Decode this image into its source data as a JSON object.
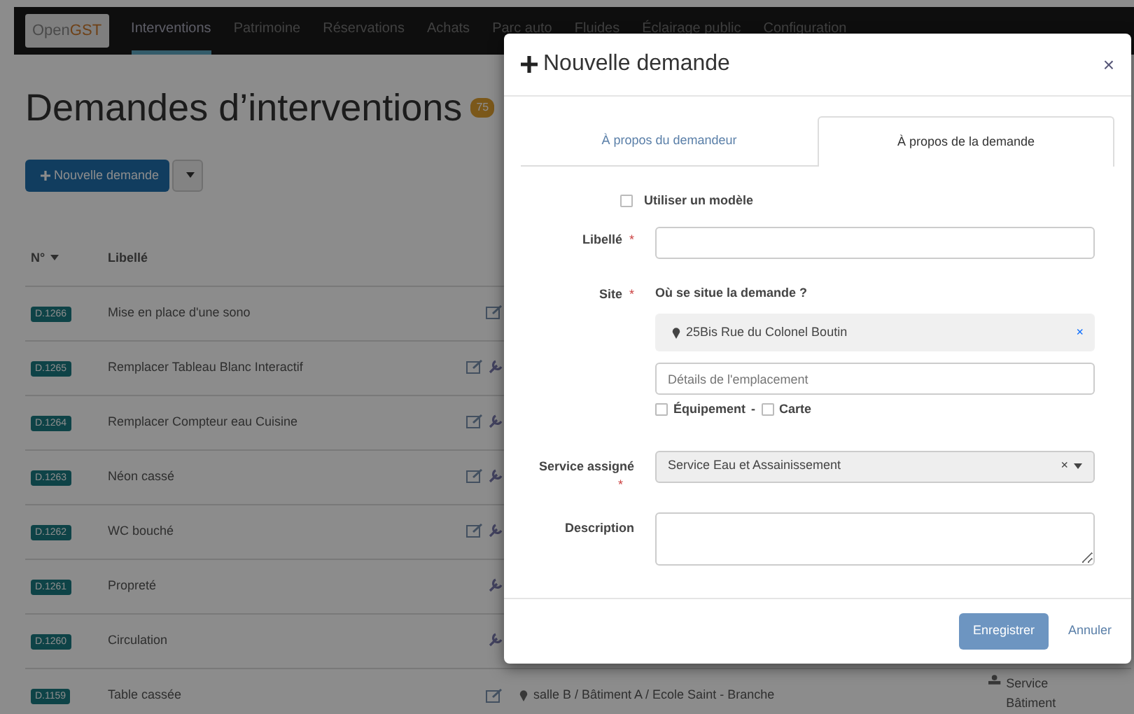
{
  "navbar": {
    "brand": "OpenGST",
    "items": [
      {
        "label": "Interventions",
        "selected": true
      },
      {
        "label": "Patrimoine",
        "selected": false
      },
      {
        "label": "Réservations",
        "selected": false
      },
      {
        "label": "Achats",
        "selected": false
      },
      {
        "label": "Parc auto",
        "selected": false
      },
      {
        "label": "Fluides",
        "selected": false
      },
      {
        "label": "Éclairage public",
        "selected": false
      },
      {
        "label": "Configuration",
        "selected": false
      }
    ]
  },
  "page": {
    "title": "Demandes d’interventions",
    "count": "75",
    "new_button": "Nouvelle demande"
  },
  "table": {
    "columns": [
      "N°",
      "Libellé"
    ],
    "rows": [
      {
        "number": "D.1266",
        "label": "Mise en place d'une sono",
        "edit": true,
        "tool": false
      },
      {
        "number": "D.1265",
        "label": "Remplacer Tableau Blanc Interactif",
        "edit": true,
        "tool": true
      },
      {
        "number": "D.1264",
        "label": "Remplacer Compteur eau Cuisine",
        "edit": true,
        "tool": true
      },
      {
        "number": "D.1263",
        "label": "Néon cassé",
        "edit": true,
        "tool": true
      },
      {
        "number": "D.1262",
        "label": "WC bouché",
        "edit": true,
        "tool": true
      },
      {
        "number": "D.1261",
        "label": "Propreté",
        "edit": false,
        "tool": true
      },
      {
        "number": "D.1260",
        "label": "Circulation",
        "edit": false,
        "tool": true
      },
      {
        "number": "D.1159",
        "label": "Table cassée",
        "edit": true,
        "tool": false,
        "site": "salle B / Bâtiment A / Ecole Saint - Branche",
        "service": "Service Bâtiment"
      }
    ]
  },
  "modal": {
    "title": "Nouvelle demande",
    "close": "×",
    "tabs": [
      {
        "label": "À propos du demandeur",
        "selected": false
      },
      {
        "label": "À propos de la demande",
        "selected": true
      }
    ],
    "template_checkbox": {
      "label": "Utiliser un modèle",
      "checked": false
    },
    "libelle": {
      "label": "Libellé",
      "required": "*"
    },
    "site": {
      "label": "Site",
      "required": "*",
      "question": "Où se situe la demande ?",
      "location": "25Bis Rue du Colonel Boutin",
      "clear": "×",
      "details_placeholder": "Détails de l'emplacement",
      "options": [
        {
          "label": "Équipement",
          "checked": false
        },
        {
          "label": "Carte",
          "checked": false
        }
      ],
      "separator": "-"
    },
    "service": {
      "label": "Service assigné",
      "required": "*",
      "value": "Service Eau et Assainissement",
      "clear": "×"
    },
    "description": {
      "label": "Description"
    },
    "buttons": {
      "save": "Enregistrer",
      "cancel": "Annuler"
    }
  }
}
